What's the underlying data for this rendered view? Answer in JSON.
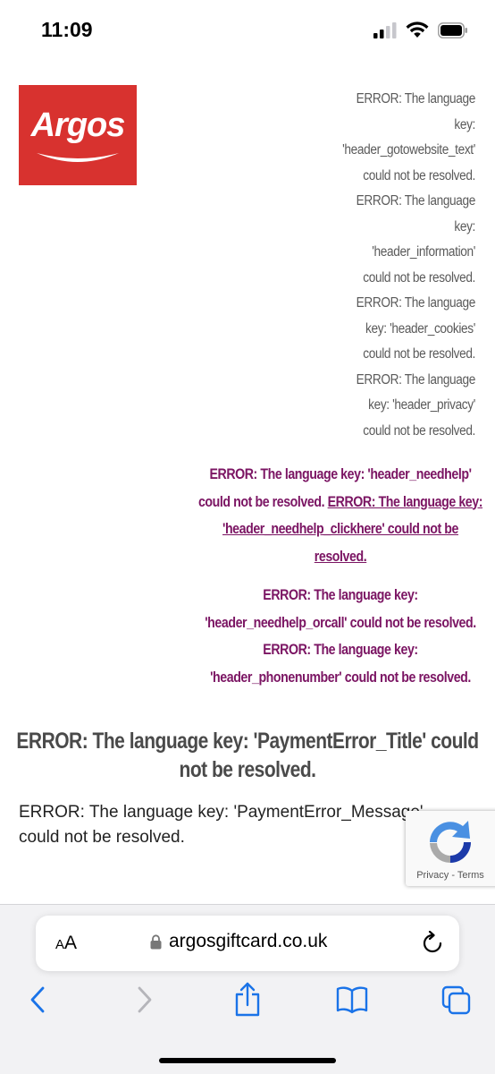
{
  "status_bar": {
    "time": "11:09",
    "icons": [
      "signal-icon",
      "wifi-icon",
      "battery-icon"
    ]
  },
  "logo": {
    "text": "Argos",
    "color": "#d8322f"
  },
  "header_errors": [
    "ERROR: The language",
    "key:",
    "'header_gotowebsite_text'",
    "could not be resolved.",
    "ERROR: The language",
    "key:",
    "'header_information'",
    "could not be resolved.",
    "ERROR: The language",
    "key: 'header_cookies'",
    "could not be resolved.",
    "ERROR: The language",
    "key: 'header_privacy'",
    "could not be resolved."
  ],
  "need_help": {
    "text_before": "ERROR: The language key: 'header_needhelp' could not be resolved. ",
    "link": "ERROR: The language key: 'header_needhelp_clickhere' could not be resolved.",
    "orcall": "ERROR: The language key: 'header_needhelp_orcall' could not be resolved.",
    "phone": "ERROR: The language key: 'header_phonenumber' could not be resolved.",
    "color": "#7b1563"
  },
  "payment_error": {
    "title": "ERROR: The language key: 'PaymentError_Title' could not be resolved.",
    "message": "ERROR: The language key: 'PaymentError_Message' could not be resolved."
  },
  "recaptcha": {
    "privacy": "Privacy",
    "separator": " - ",
    "terms": "Terms"
  },
  "browser": {
    "aa_label_big": "A",
    "aa_label_small": "A",
    "url": "argosgiftcard.co.uk",
    "accent": "#1a73e8",
    "toolbar_icons": [
      "back-icon",
      "forward-icon",
      "share-icon",
      "bookmarks-icon",
      "tabs-icon"
    ]
  }
}
